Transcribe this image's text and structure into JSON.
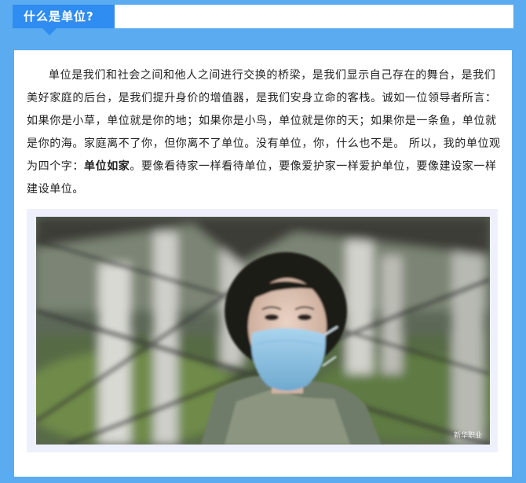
{
  "header": {
    "title": "什么是单位?"
  },
  "article": {
    "p1": "单位是我们和社会之间和他人之间进行交换的桥梁，是我们显示自己存在的舞台，是我们美好家庭的后台，是我们提升身价的增值器，是我们安身立命的客栈。诚如一位领导者所言：如果你是小草，单位就是你的地；如果你是小鸟，单位就是你的天；如果你是一条鱼，单位就是你的海。家庭离不了你，但你离不了单位。没有单位，你，什么也不是。 所以，我的单位观为四个字：",
    "p1_bold": "单位如家",
    "p2": "。要像看待家一样看待单位，要像爱护家一样爱护单位，要像建设家一样建设单位。"
  },
  "photo": {
    "watermark": "新华职业"
  },
  "colors": {
    "frame": "#5aabf0",
    "tab": "#2f8cf0",
    "mask": "#8fc4e6"
  }
}
